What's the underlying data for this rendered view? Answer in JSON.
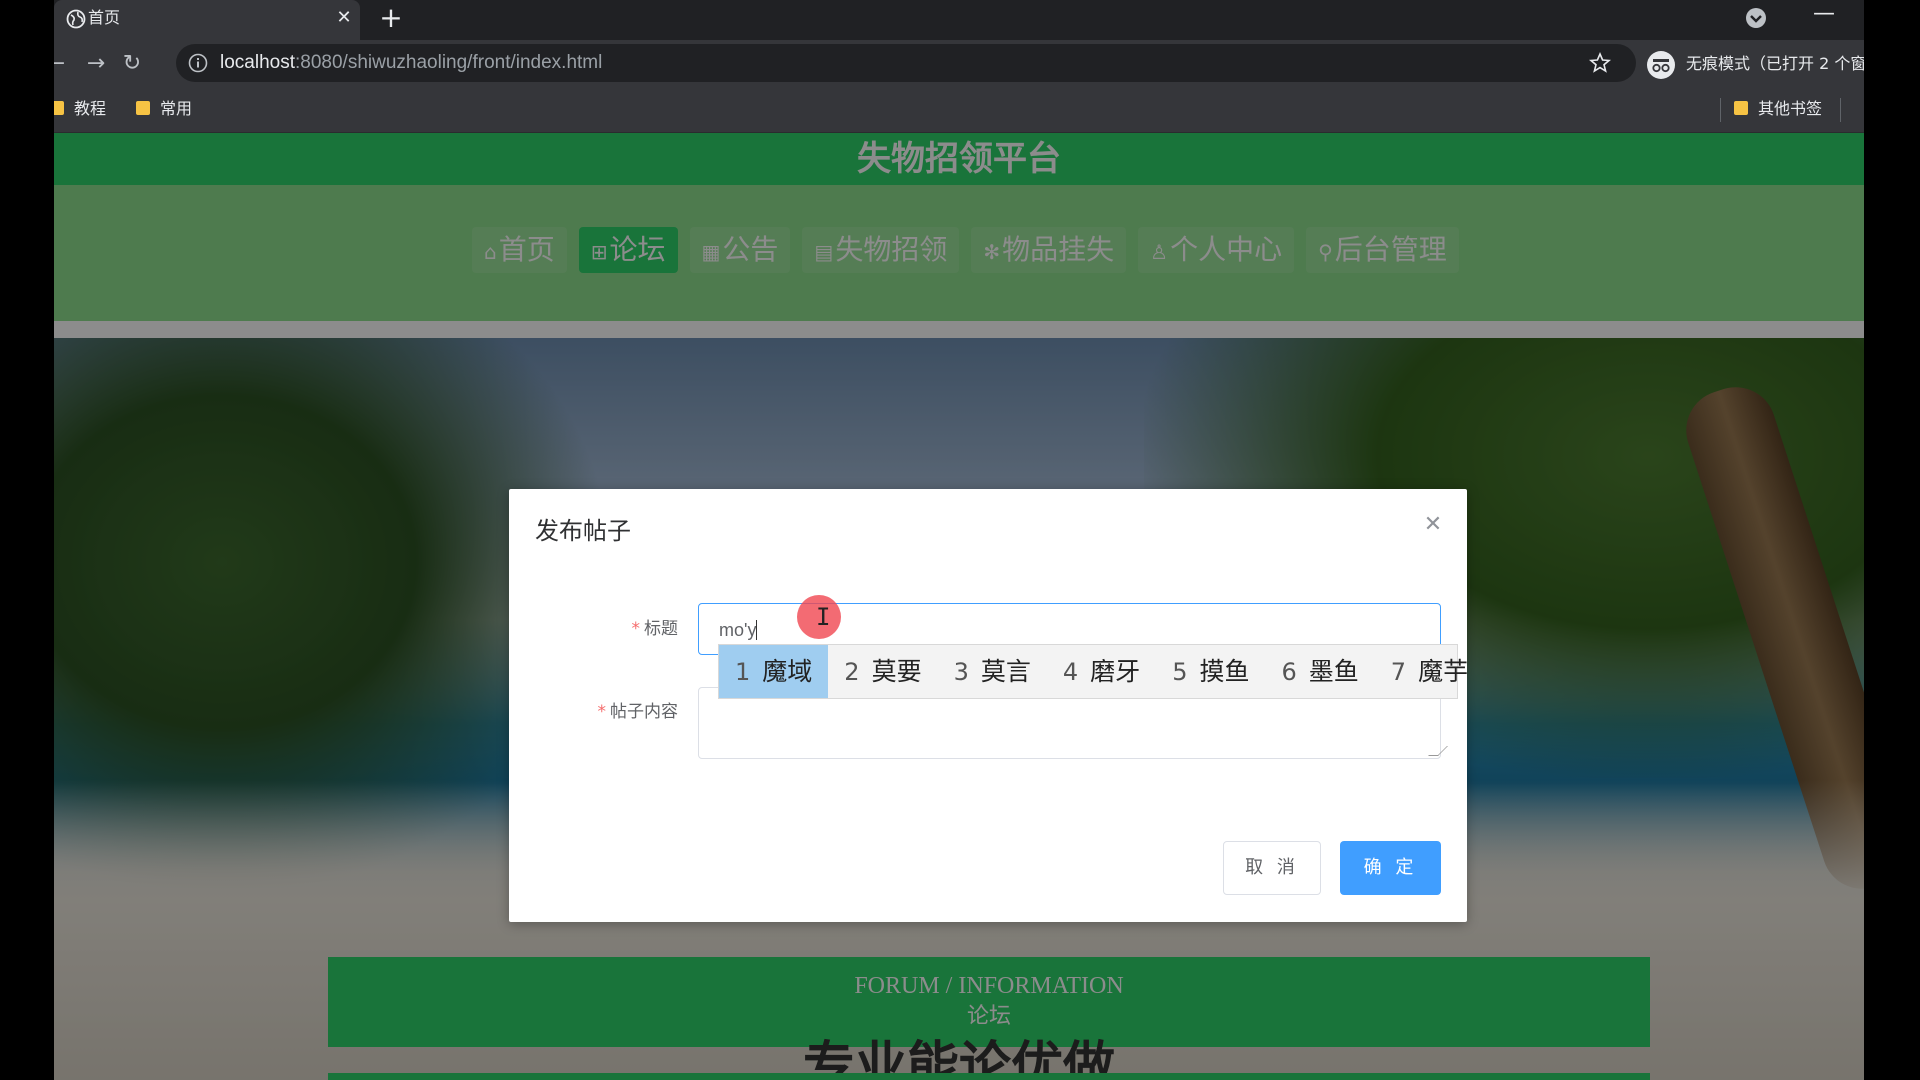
{
  "browser": {
    "tab_title": "首页",
    "tab_close": "✕",
    "new_tab": "+",
    "win_min": "—",
    "url_host": "localhost",
    "url_path": ":8080/shiwuzhaoling/front/index.html",
    "incognito_text": "无痕模式（已打开 2 个窗",
    "bookmarks": [
      "教程",
      "常用",
      "其他书签"
    ]
  },
  "site": {
    "title": "失物招领平台",
    "nav": [
      {
        "icon": "⌂",
        "label": "首页",
        "active": false
      },
      {
        "icon": "⊞",
        "label": "论坛",
        "active": true
      },
      {
        "icon": "▦",
        "label": "公告",
        "active": false
      },
      {
        "icon": "▤",
        "label": "失物招领",
        "active": false
      },
      {
        "icon": "✻",
        "label": "物品挂失",
        "active": false
      },
      {
        "icon": "♙",
        "label": "个人中心",
        "active": false
      },
      {
        "icon": "⚲",
        "label": "后台管理",
        "active": false
      }
    ],
    "section_en": "FORUM / INFORMATION",
    "section_cn": "论坛",
    "big_text": "专业能论优做"
  },
  "dialog": {
    "title": "发布帖子",
    "close": "✕",
    "label_title": "标题",
    "label_content": "帖子内容",
    "title_value": "mo'y",
    "cancel": "取 消",
    "confirm": "确 定"
  },
  "ime": {
    "candidates": [
      {
        "num": "1",
        "text": "魔域"
      },
      {
        "num": "2",
        "text": "莫要"
      },
      {
        "num": "3",
        "text": "莫言"
      },
      {
        "num": "4",
        "text": "磨牙"
      },
      {
        "num": "5",
        "text": "摸鱼"
      },
      {
        "num": "6",
        "text": "墨鱼"
      },
      {
        "num": "7",
        "text": "魔芋"
      }
    ]
  },
  "colors": {
    "brand_green": "#2ed36b",
    "nav_green": "#8fe08f",
    "primary_blue": "#409eff"
  }
}
